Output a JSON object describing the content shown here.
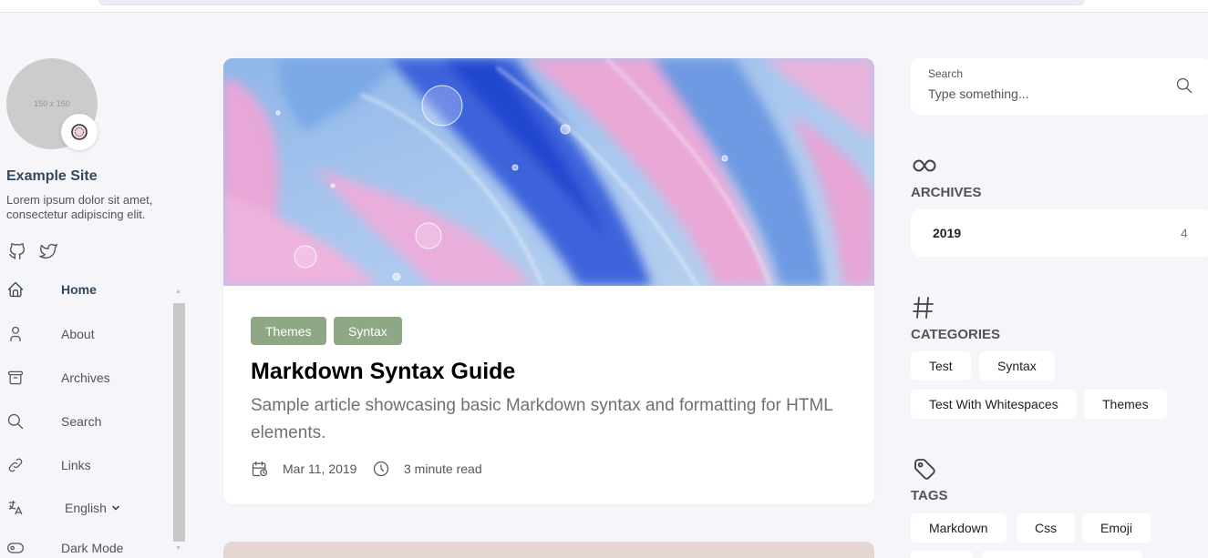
{
  "profile": {
    "avatar_text": "150 x 150",
    "site_name": "Example Site",
    "site_description": "Lorem ipsum dolor sit amet, consectetur adipiscing elit."
  },
  "nav": {
    "items": [
      {
        "label": "Home",
        "icon": "home-icon",
        "active": true
      },
      {
        "label": "About",
        "icon": "user-icon"
      },
      {
        "label": "Archives",
        "icon": "archive-icon"
      },
      {
        "label": "Search",
        "icon": "search-icon"
      },
      {
        "label": "Links",
        "icon": "link-icon"
      }
    ],
    "language": "English",
    "dark_mode_label": "Dark Mode"
  },
  "article": {
    "categories": [
      "Themes",
      "Syntax"
    ],
    "title": "Markdown Syntax Guide",
    "subtitle": "Sample article showcasing basic Markdown syntax and formatting for HTML elements.",
    "date": "Mar 11, 2019",
    "read_time": "3 minute read"
  },
  "widgets": {
    "search": {
      "label": "Search",
      "placeholder": "Type something..."
    },
    "archives": {
      "title": "ARCHIVES",
      "year": "2019",
      "count": "4"
    },
    "categories": {
      "title": "CATEGORIES",
      "items": [
        "Test",
        "Syntax",
        "Test With Whitespaces",
        "Themes"
      ]
    },
    "tags": {
      "title": "TAGS",
      "items": [
        "Markdown",
        "Css",
        "Emoji"
      ]
    }
  },
  "colors": {
    "accent": "#8ea885",
    "background": "#f5f5fa",
    "title_text": "#34495e"
  }
}
